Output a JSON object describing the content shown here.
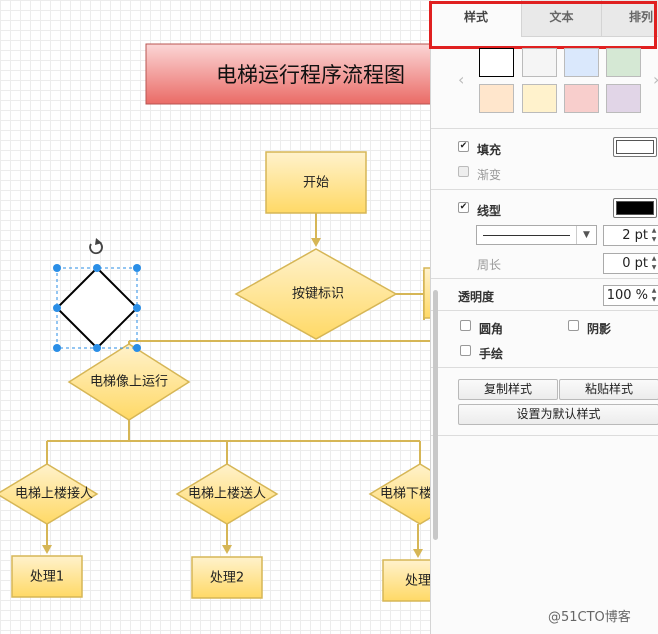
{
  "canvas": {
    "title": "电梯运行程序流程图",
    "shapes": {
      "start": "开始",
      "key_flag": "按键标识",
      "elevator_up": "电梯像上运行",
      "up_pickup": "电梯上楼接人",
      "up_dropoff": "电梯上楼送人",
      "down_pickup": "电梯下楼",
      "process1": "处理1",
      "process2": "处理2",
      "process3": "处理"
    }
  },
  "panel": {
    "tabs": [
      "样式",
      "文本",
      "排列"
    ],
    "swatch_colors": [
      "#ffffff",
      "#f5f5f5",
      "#dae8fc",
      "#d5e8d4",
      "#ffe6cc",
      "#fff2cc",
      "#f8cecc",
      "#e1d5e7"
    ],
    "fill_label": "填充",
    "gradient_label": "渐变",
    "fill_color": "#ffffff",
    "line_label": "线型",
    "line_color": "#000000",
    "line_width": "2 pt",
    "perimeter_label": "周长",
    "perimeter_value": "0 pt",
    "opacity_label": "透明度",
    "opacity_value": "100 %",
    "rounded_label": "圆角",
    "shadow_label": "阴影",
    "sketch_label": "手绘",
    "copy_style": "复制样式",
    "paste_style": "粘贴样式",
    "set_default": "设置为默认样式"
  },
  "watermark": "@51CTO博客"
}
